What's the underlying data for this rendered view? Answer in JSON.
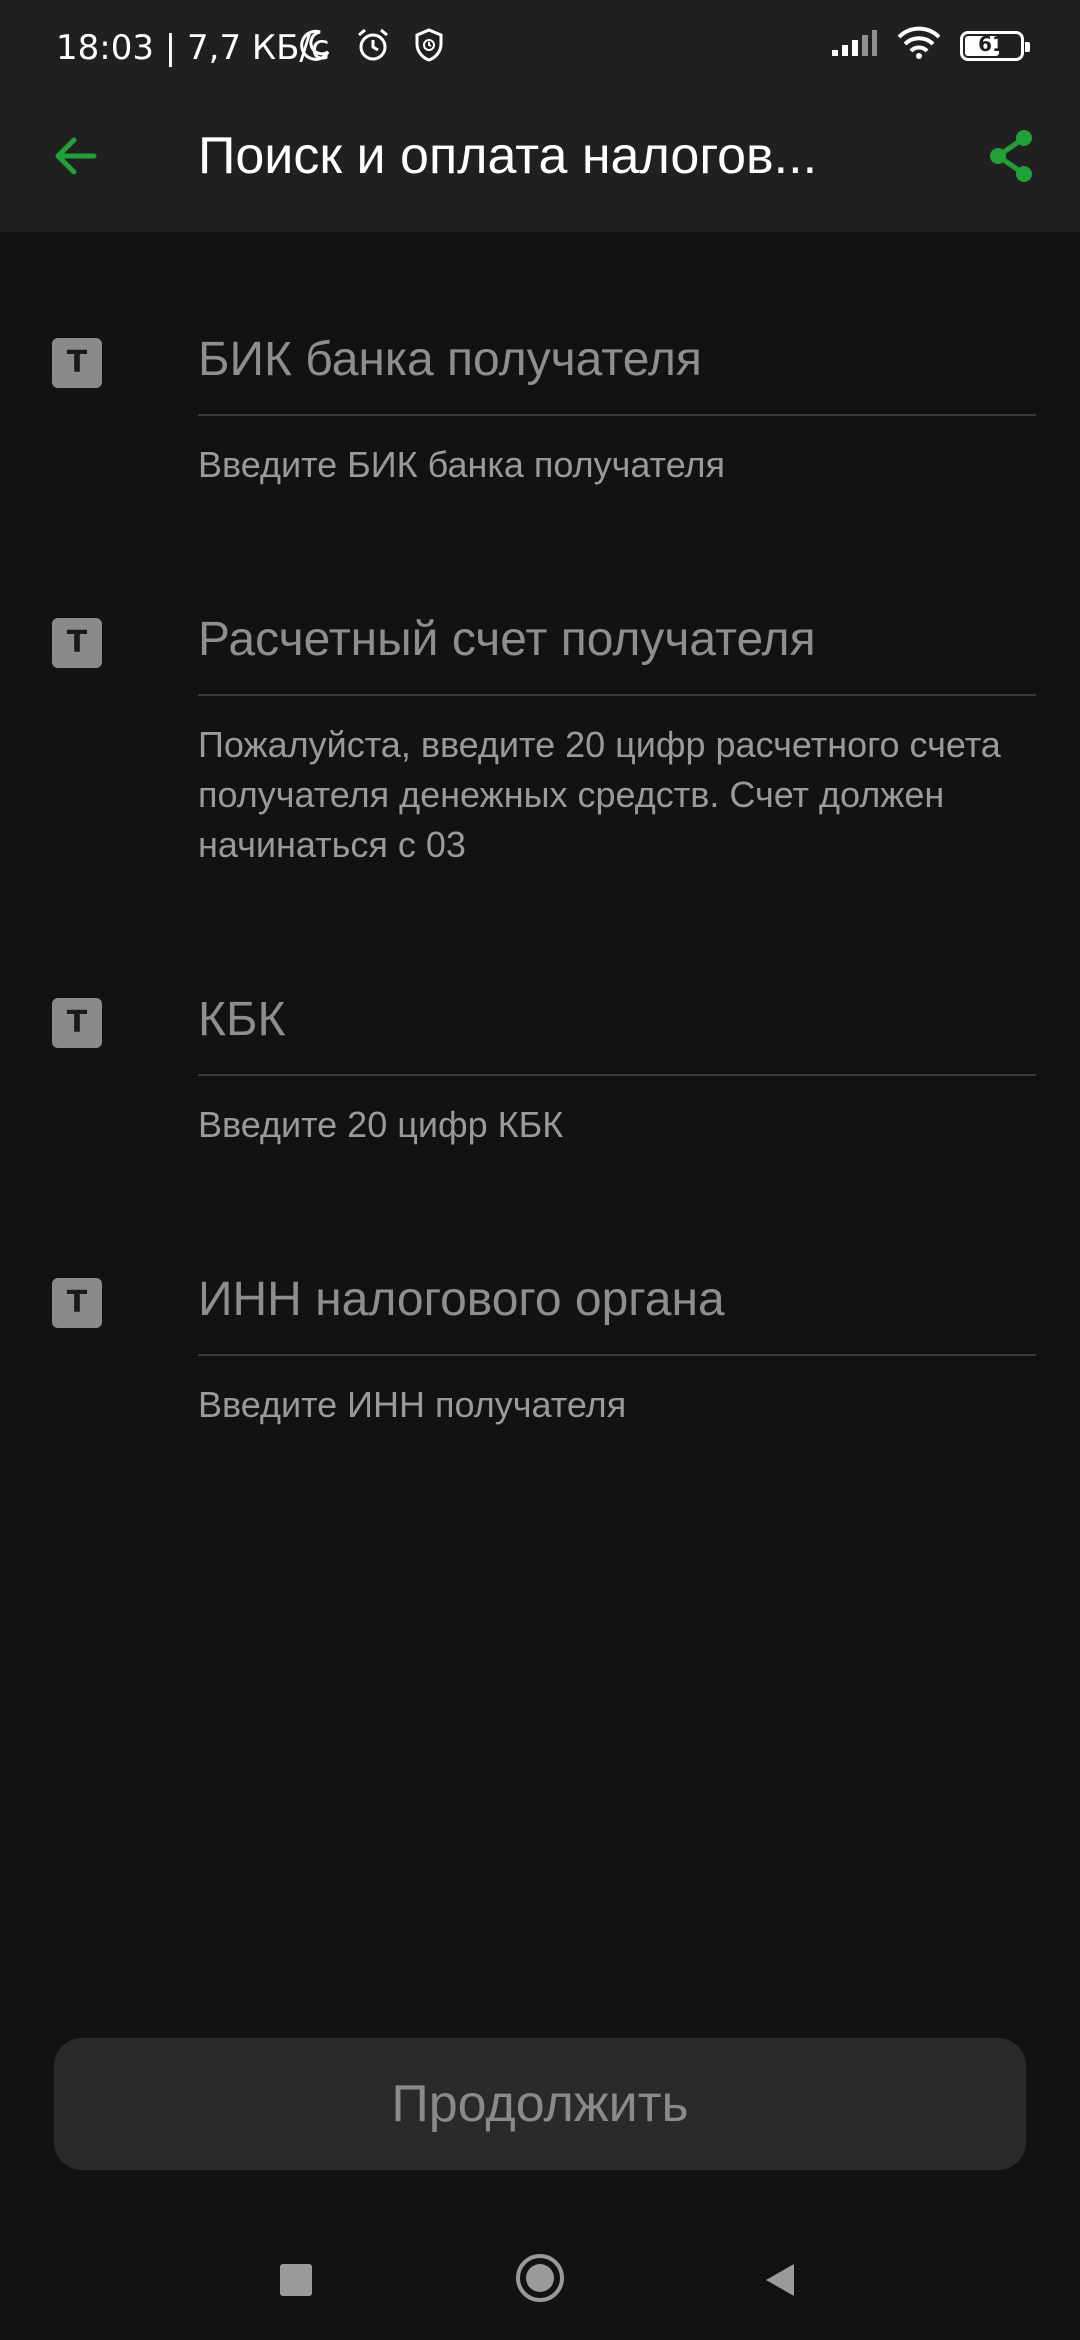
{
  "status_bar": {
    "time_speed": "18:03 | 7,7 КБ/с",
    "battery": "61",
    "icons": [
      "moon-icon",
      "alarm-icon",
      "shield-icon",
      "signal-icon",
      "wifi-icon",
      "battery-icon"
    ]
  },
  "app_bar": {
    "title": "Поиск и оплата налогов...",
    "back_icon": "arrow-left-icon",
    "share_icon": "share-icon"
  },
  "form": {
    "fields": [
      {
        "type_icon": "T",
        "label": "БИК банка получателя",
        "hint": "Введите БИК банка получателя"
      },
      {
        "type_icon": "T",
        "label": "Расчетный счет получателя",
        "hint": "Пожалуйста, введите 20 цифр расчетного счета получателя денежных средств. Счет должен начинаться с 03"
      },
      {
        "type_icon": "T",
        "label": "КБК",
        "hint": "Введите 20 цифр КБК"
      },
      {
        "type_icon": "T",
        "label": "ИНН налогового органа",
        "hint": "Введите ИНН получателя"
      }
    ]
  },
  "continue_button": {
    "label": "Продолжить"
  },
  "colors": {
    "accent": "#21a038",
    "background": "#121212",
    "surface": "#202020"
  },
  "nav_bar": {
    "icons": [
      "recents-icon",
      "home-icon",
      "back-icon"
    ]
  }
}
